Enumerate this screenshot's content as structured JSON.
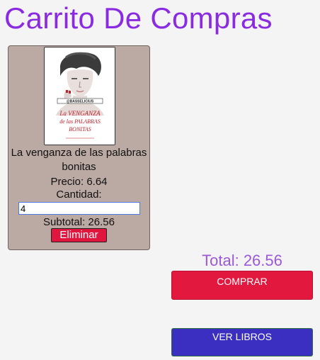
{
  "header": {
    "title": "Carrito De Compras"
  },
  "cart": {
    "items": [
      {
        "name": "La venganza de las palabras bonitas",
        "price_text": "Precio: 6.64",
        "quantity_label": "Cantidad:",
        "quantity": "4",
        "subtotal_text": "Subtotal: 26.56",
        "remove_label": "Eliminar",
        "cover": {
          "author_tag": "@BASSELICIUS",
          "title_lines": [
            "La VENGANZA",
            "de las PALABRAS",
            "BONITAS"
          ],
          "colors": {
            "title": "#c0202a",
            "hair": "#3c3c3c",
            "bg": "#ffffff"
          },
          "icon": "book-cover-illustration"
        }
      }
    ]
  },
  "summary": {
    "total_text": "Total: 26.56",
    "buy_label": "COMPRAR",
    "books_label": "VER LIBROS"
  },
  "colors": {
    "title": "#8a2be2",
    "card_bg": "#bba9a4",
    "danger": "#e1163f",
    "primary": "#3a2fc1",
    "total": "#9b59d6"
  }
}
